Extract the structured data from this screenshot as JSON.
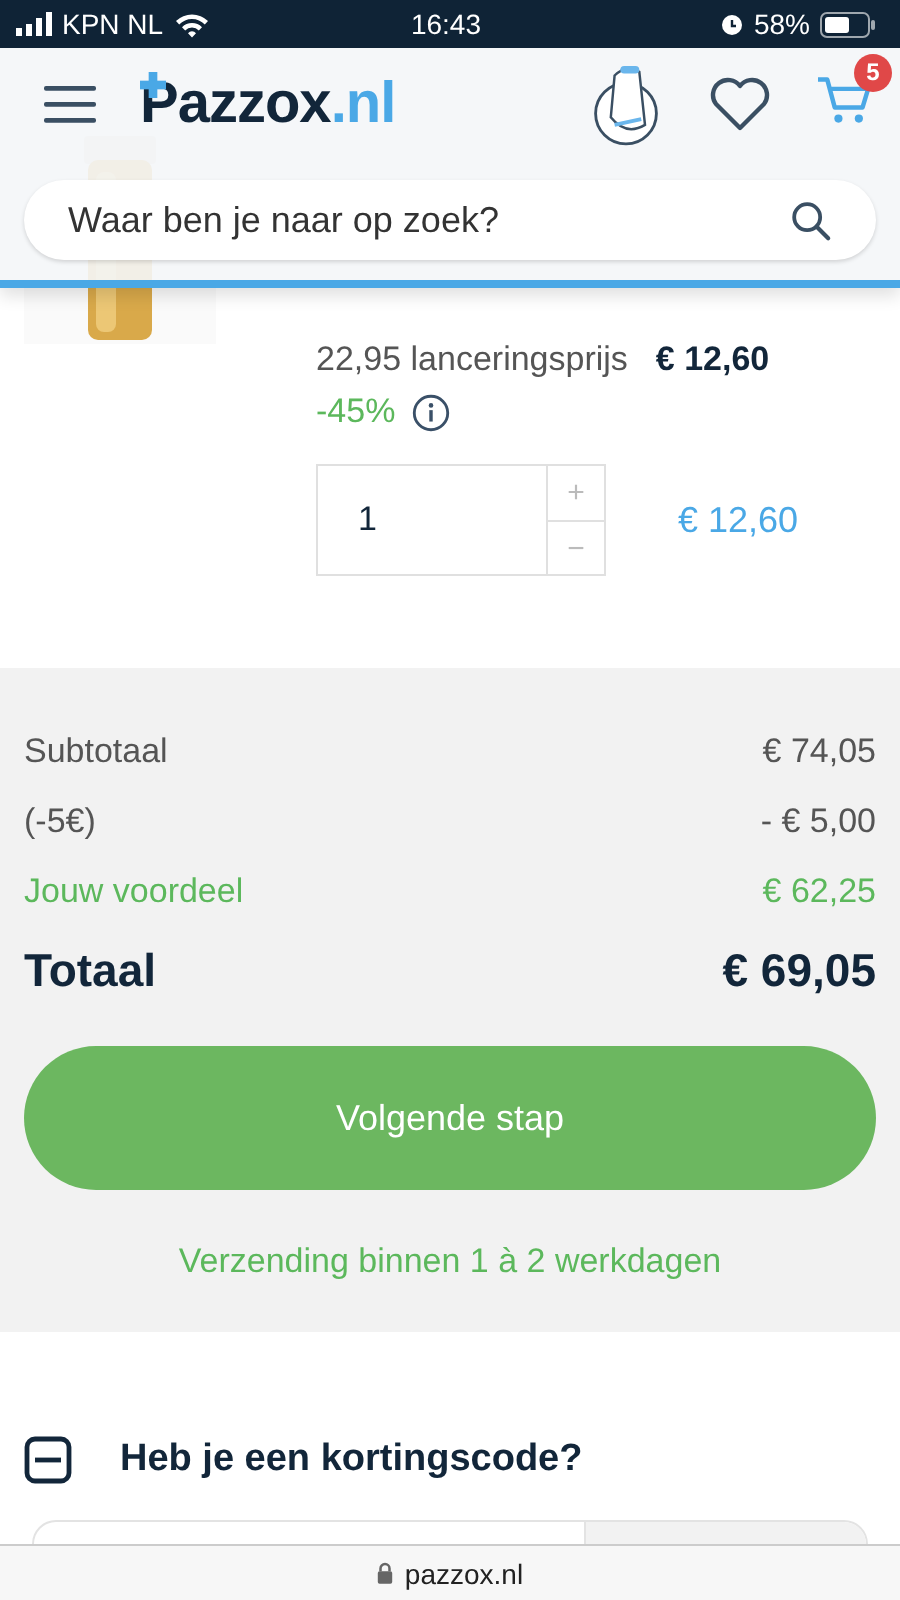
{
  "status_bar": {
    "carrier": "KPN NL",
    "time": "16:43",
    "battery": "58%"
  },
  "header": {
    "logo": "Pazzox",
    "logo_domain": ".nl",
    "cart_count": "5",
    "search": {
      "placeholder": "Waar ben je naar op zoek?"
    }
  },
  "product": {
    "original_price": "22,95 lanceringsprijs",
    "price": "€ 12,60",
    "discount": "-45%",
    "quantity": "1",
    "increment": "+",
    "decrement": "−",
    "line_total": "€ 12,60"
  },
  "summary": {
    "rows": [
      {
        "kind": "normal",
        "label": "Subtotaal",
        "value": "€ 74,05"
      },
      {
        "kind": "normal",
        "label": "(-5€)",
        "value": "- € 5,00"
      },
      {
        "kind": "savings",
        "label": "Jouw voordeel",
        "value": "€ 62,25"
      },
      {
        "kind": "total",
        "label": "Totaal",
        "value": "€ 69,05"
      }
    ],
    "next_button": "Volgende stap",
    "shipping": "Verzending binnen 1 à 2 werkdagen"
  },
  "coupon": {
    "title": "Heb je een kortingscode?",
    "expanded": true
  },
  "browser_bar": {
    "url": "pazzox.nl"
  }
}
